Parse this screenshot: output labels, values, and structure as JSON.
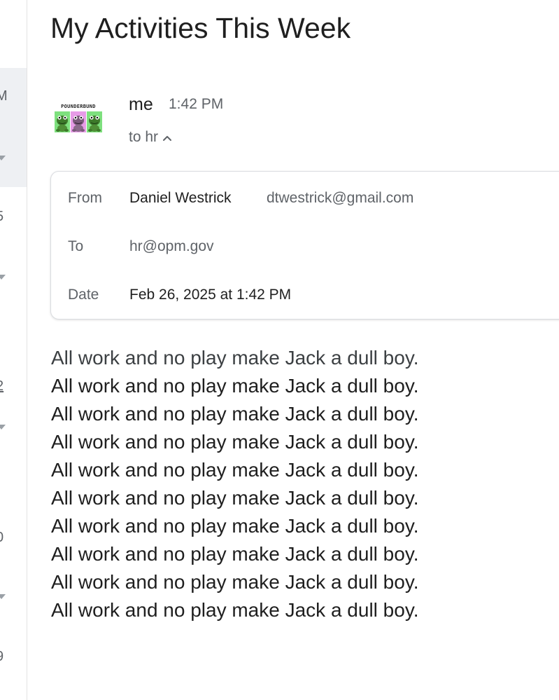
{
  "email": {
    "subject": "My Activities This Week",
    "sender": {
      "name": "me",
      "time": "1:42 PM",
      "to_summary": "to hr",
      "avatar_banner": "POUNDERBUND"
    },
    "details": {
      "from_label": "From",
      "from_name": "Daniel Westrick",
      "from_email": "dtwestrick@gmail.com",
      "to_label": "To",
      "to_value": "hr@opm.gov",
      "date_label": "Date",
      "date_value": "Feb 26, 2025 at 1:42 PM"
    },
    "body_lines": [
      "All work and no play make Jack a dull boy.",
      "All work and no play make Jack a dull boy.",
      "All work and no play make Jack a dull boy.",
      "All work and no play make Jack a dull boy.",
      "All work and no play make Jack a dull boy.",
      "All work and no play make Jack a dull boy.",
      "All work and no play make Jack a dull boy.",
      "All work and no play make Jack a dull boy.",
      "All work and no play make Jack a dull boy.",
      "All work and no play make Jack a dull boy."
    ]
  },
  "left_rail": {
    "fragments": [
      "M",
      "5",
      "2",
      "0",
      "9"
    ]
  },
  "icons": {
    "details_toggle": "chevron-up-icon",
    "avatar": "frog-avatar-icon"
  },
  "colors": {
    "text_primary": "#1f1f1f",
    "text_secondary": "#5f6368",
    "card_border": "#dadce0",
    "rail_selected": "#eef0f3",
    "frog_green_bg": "#7ee07e",
    "frog_pink_bg": "#e79be7"
  }
}
